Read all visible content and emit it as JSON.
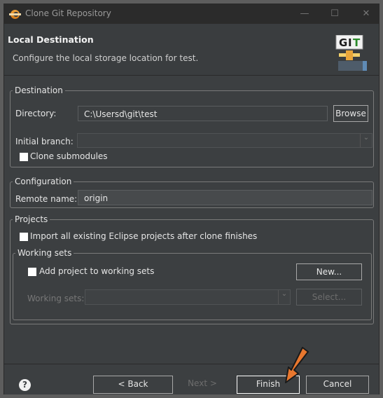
{
  "window": {
    "title": "Clone Git Repository",
    "minimize_icon": "minimize-icon",
    "maximize_icon": "maximize-icon",
    "close_icon": "close-icon"
  },
  "header": {
    "title": "Local Destination",
    "description": "Configure the local storage location for test.",
    "logo_text": "GIT"
  },
  "destination": {
    "legend": "Destination",
    "directory_label": "Directory:",
    "directory_value": "C:\\Usersd\\git\\test",
    "browse_label": "Browse",
    "initial_branch_label": "Initial branch:",
    "initial_branch_value": "",
    "clone_submodules_label": "Clone submodules",
    "clone_submodules_checked": false
  },
  "configuration": {
    "legend": "Configuration",
    "remote_name_label": "Remote name:",
    "remote_name_value": "origin"
  },
  "projects": {
    "legend": "Projects",
    "import_label": "Import all existing Eclipse projects after clone finishes",
    "import_checked": false,
    "working_sets_legend": "Working sets",
    "add_to_working_sets_label": "Add project to working sets",
    "add_to_working_sets_checked": false,
    "new_label": "New...",
    "working_sets_label": "Working sets:",
    "working_sets_value": "",
    "select_label": "Select..."
  },
  "footer": {
    "back_label": "< Back",
    "next_label": "Next >",
    "finish_label": "Finish",
    "cancel_label": "Cancel"
  },
  "colors": {
    "background": "#3c3f41",
    "annotation_arrow": "#e8772e"
  }
}
